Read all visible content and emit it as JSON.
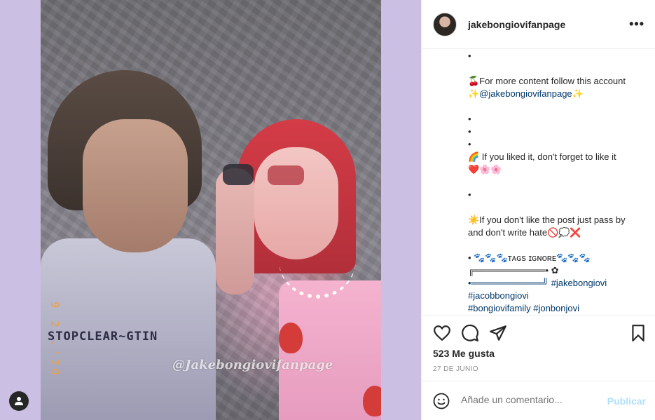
{
  "post": {
    "username": "jakebongiovifanpage",
    "more_label": "•••",
    "watermark": "@Jakebongiovifanpage",
    "date_stamp": "9 2 .'20"
  },
  "caption": {
    "lines": [
      "•",
      "",
      "🍒For more content follow this account",
      "✨@jakebongiovifanpage✨",
      "",
      "•",
      "•",
      "•",
      "🌈 If you liked it, don't forget to like it",
      "❤️🌸🌸",
      "",
      "•",
      "",
      "☀️If you don't like the post just pass by",
      "and don't write hate🚫💭❌",
      "",
      "• 🐾🐾🐾ᴛᴀɢs ɪɢɴᴏʀᴇ🐾🐾🐾",
      "╔═══════════• ✿",
      "•═══════════╝ #jakebongiovi",
      "#jacobbongiovi",
      "#bongiovifamily #jonbonjovi"
    ]
  },
  "stats": {
    "likes": "523 Me gusta",
    "date": "27 DE JUNIO"
  },
  "comment": {
    "placeholder": "Añade un comentario...",
    "publish": "Publicar"
  },
  "colors": {
    "photo_background": "#cbbfe3",
    "link": "#00376b",
    "publish_disabled": "#b2dffc"
  },
  "icons": {
    "like": "heart-icon",
    "comment": "speech-bubble-icon",
    "share": "paper-plane-icon",
    "save": "bookmark-icon",
    "emoji": "smiley-icon",
    "user_tag": "person-icon",
    "more": "ellipsis-icon"
  }
}
